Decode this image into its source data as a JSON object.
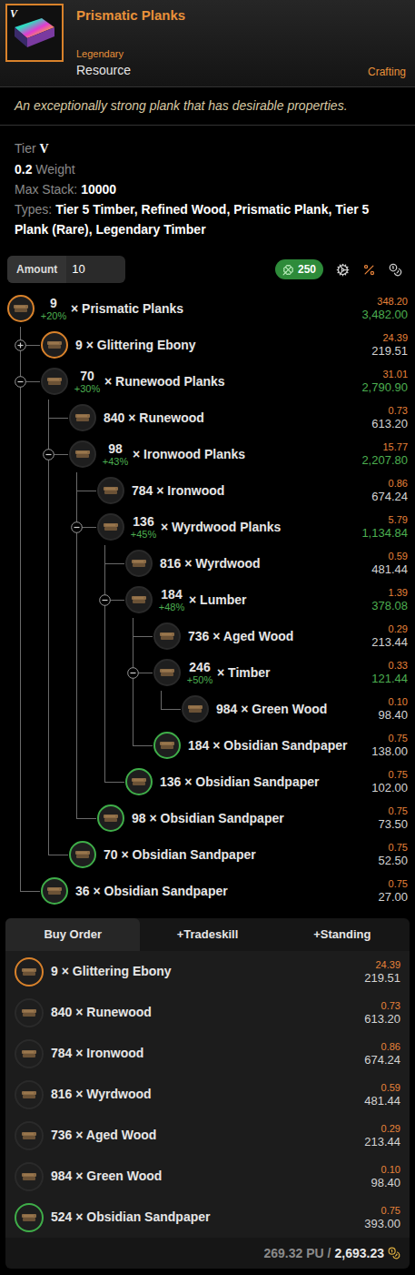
{
  "item": {
    "tier_badge": "V",
    "title": "Prismatic Planks",
    "rarity": "Legendary",
    "category": "Resource",
    "tag": "Crafting",
    "description": "An exceptionally strong plank that has desirable properties.",
    "stats": {
      "tier_label": "Tier",
      "tier": "V",
      "weight": "0.2",
      "weight_label": "Weight",
      "max_stack_label": "Max Stack:",
      "max_stack": "10000",
      "types_label": "Types:",
      "types": "Tier 5 Timber, Refined Wood, Prismatic Plank, Tier 5 Plank (Rare), Legendary Timber"
    }
  },
  "toolbar": {
    "amount_label": "Amount",
    "amount": "10",
    "luck": "250"
  },
  "tree": {
    "sign": "×",
    "root": {
      "qty": "9",
      "bonus": "+20%",
      "name": "Prismatic Planks",
      "unit": "348.20",
      "total": "3,482.00",
      "color": "#d9822b",
      "expandable": true,
      "expanded": true,
      "children": [
        {
          "qty": "9",
          "bonus": "",
          "name": "Glittering Ebony",
          "unit": "24.39",
          "total": "219.51",
          "color": "#d9822b",
          "expandable": true,
          "expanded": false,
          "children": []
        },
        {
          "qty": "70",
          "bonus": "+30%",
          "name": "Runewood Planks",
          "unit": "31.01",
          "total": "2,790.90",
          "color": "#2a2a2a",
          "expandable": true,
          "expanded": true,
          "children": [
            {
              "qty": "840",
              "bonus": "",
              "name": "Runewood",
              "unit": "0.73",
              "total": "613.20",
              "color": "#2a2a2a",
              "expandable": false,
              "expanded": false,
              "children": []
            },
            {
              "qty": "98",
              "bonus": "+43%",
              "name": "Ironwood Planks",
              "unit": "15.77",
              "total": "2,207.80",
              "color": "#2a2a2a",
              "expandable": true,
              "expanded": true,
              "children": [
                {
                  "qty": "784",
                  "bonus": "",
                  "name": "Ironwood",
                  "unit": "0.86",
                  "total": "674.24",
                  "color": "#2a2a2a",
                  "expandable": false,
                  "expanded": false,
                  "children": []
                },
                {
                  "qty": "136",
                  "bonus": "+45%",
                  "name": "Wyrdwood Planks",
                  "unit": "5.79",
                  "total": "1,134.84",
                  "color": "#2a2a2a",
                  "expandable": true,
                  "expanded": true,
                  "children": [
                    {
                      "qty": "816",
                      "bonus": "",
                      "name": "Wyrdwood",
                      "unit": "0.59",
                      "total": "481.44",
                      "color": "#2a2a2a",
                      "expandable": false,
                      "expanded": false,
                      "children": []
                    },
                    {
                      "qty": "184",
                      "bonus": "+48%",
                      "name": "Lumber",
                      "unit": "1.39",
                      "total": "378.08",
                      "color": "#2a2a2a",
                      "expandable": true,
                      "expanded": true,
                      "children": [
                        {
                          "qty": "736",
                          "bonus": "",
                          "name": "Aged Wood",
                          "unit": "0.29",
                          "total": "213.44",
                          "color": "#2a2a2a",
                          "expandable": false,
                          "expanded": false,
                          "children": []
                        },
                        {
                          "qty": "246",
                          "bonus": "+50%",
                          "name": "Timber",
                          "unit": "0.33",
                          "total": "121.44",
                          "color": "#2a2a2a",
                          "expandable": true,
                          "expanded": true,
                          "children": [
                            {
                              "qty": "984",
                              "bonus": "",
                              "name": "Green Wood",
                              "unit": "0.10",
                              "total": "98.40",
                              "color": "#2a2a2a",
                              "expandable": false,
                              "expanded": false,
                              "children": []
                            }
                          ]
                        },
                        {
                          "qty": "184",
                          "bonus": "",
                          "name": "Obsidian Sandpaper",
                          "unit": "0.75",
                          "total": "138.00",
                          "color": "#3fae49",
                          "expandable": false,
                          "expanded": false,
                          "children": []
                        }
                      ]
                    },
                    {
                      "qty": "136",
                      "bonus": "",
                      "name": "Obsidian Sandpaper",
                      "unit": "0.75",
                      "total": "102.00",
                      "color": "#3fae49",
                      "expandable": false,
                      "expanded": false,
                      "children": []
                    }
                  ]
                },
                {
                  "qty": "98",
                  "bonus": "",
                  "name": "Obsidian Sandpaper",
                  "unit": "0.75",
                  "total": "73.50",
                  "color": "#3fae49",
                  "expandable": false,
                  "expanded": false,
                  "children": []
                }
              ]
            },
            {
              "qty": "70",
              "bonus": "",
              "name": "Obsidian Sandpaper",
              "unit": "0.75",
              "total": "52.50",
              "color": "#3fae49",
              "expandable": false,
              "expanded": false,
              "children": []
            }
          ]
        },
        {
          "qty": "36",
          "bonus": "",
          "name": "Obsidian Sandpaper",
          "unit": "0.75",
          "total": "27.00",
          "color": "#3fae49",
          "expandable": false,
          "expanded": false,
          "children": []
        }
      ]
    }
  },
  "tabs": [
    {
      "label": "Buy Order",
      "selected": true
    },
    {
      "label": "+Tradeskill",
      "selected": false
    },
    {
      "label": "+Standing",
      "selected": false
    }
  ],
  "buy_order": [
    {
      "qty": "9",
      "name": "Glittering Ebony",
      "unit": "24.39",
      "total": "219.51",
      "color": "#d9822b"
    },
    {
      "qty": "840",
      "name": "Runewood",
      "unit": "0.73",
      "total": "613.20",
      "color": "#2a2a2a"
    },
    {
      "qty": "784",
      "name": "Ironwood",
      "unit": "0.86",
      "total": "674.24",
      "color": "#2a2a2a"
    },
    {
      "qty": "816",
      "name": "Wyrdwood",
      "unit": "0.59",
      "total": "481.44",
      "color": "#2a2a2a"
    },
    {
      "qty": "736",
      "name": "Aged Wood",
      "unit": "0.29",
      "total": "213.44",
      "color": "#2a2a2a"
    },
    {
      "qty": "984",
      "name": "Green Wood",
      "unit": "0.10",
      "total": "98.40",
      "color": "#2a2a2a"
    },
    {
      "qty": "524",
      "name": "Obsidian Sandpaper",
      "unit": "0.75",
      "total": "393.00",
      "color": "#3fae49"
    }
  ],
  "footer": {
    "pu": "269.32 PU",
    "separator": "/",
    "total": "2,693.23"
  }
}
